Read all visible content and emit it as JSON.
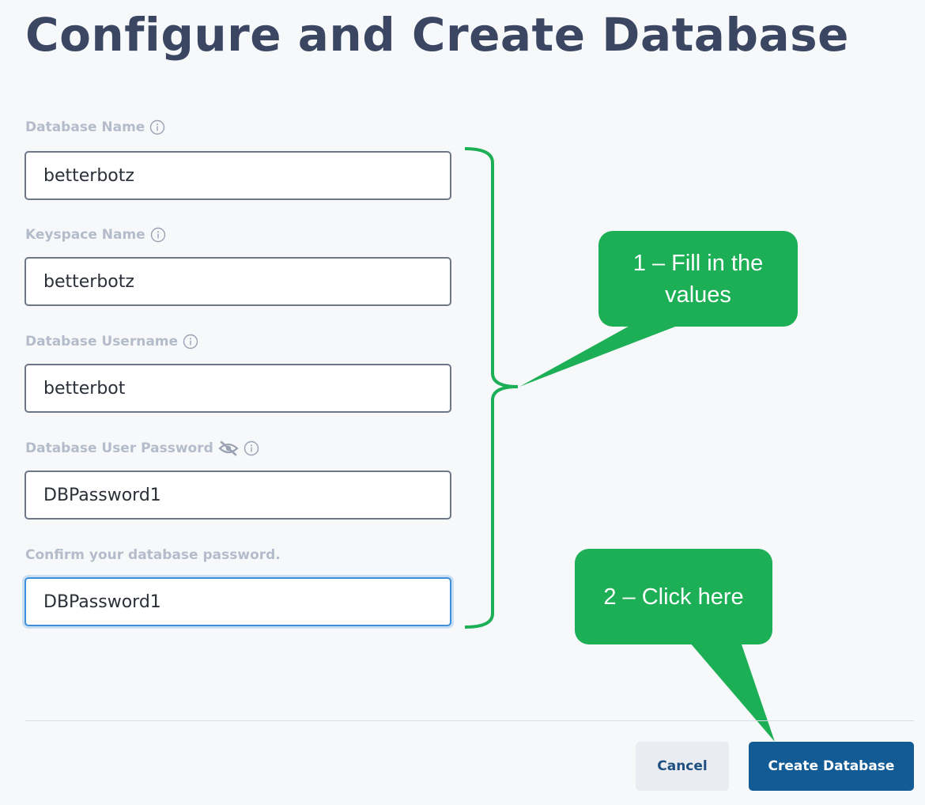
{
  "page": {
    "title": "Configure and Create Database"
  },
  "form": {
    "database_name": {
      "label": "Database Name",
      "value": "betterbotz",
      "info_icon": "info-icon"
    },
    "keyspace_name": {
      "label": "Keyspace Name",
      "value": "betterbotz",
      "info_icon": "info-icon"
    },
    "database_username": {
      "label": "Database Username",
      "value": "betterbot",
      "info_icon": "info-icon"
    },
    "database_password": {
      "label": "Database User Password",
      "value": "DBPassword1",
      "visibility_icon": "eye-slash-icon",
      "info_icon": "info-icon"
    },
    "confirm_password": {
      "label": "Confirm your database password.",
      "value": "DBPassword1"
    }
  },
  "annotations": {
    "callout_1": "1 – Fill in the values",
    "callout_2": "2 – Click here",
    "color": "#1daf55"
  },
  "actions": {
    "cancel_label": "Cancel",
    "create_label": "Create Database",
    "primary_color": "#125b94"
  }
}
